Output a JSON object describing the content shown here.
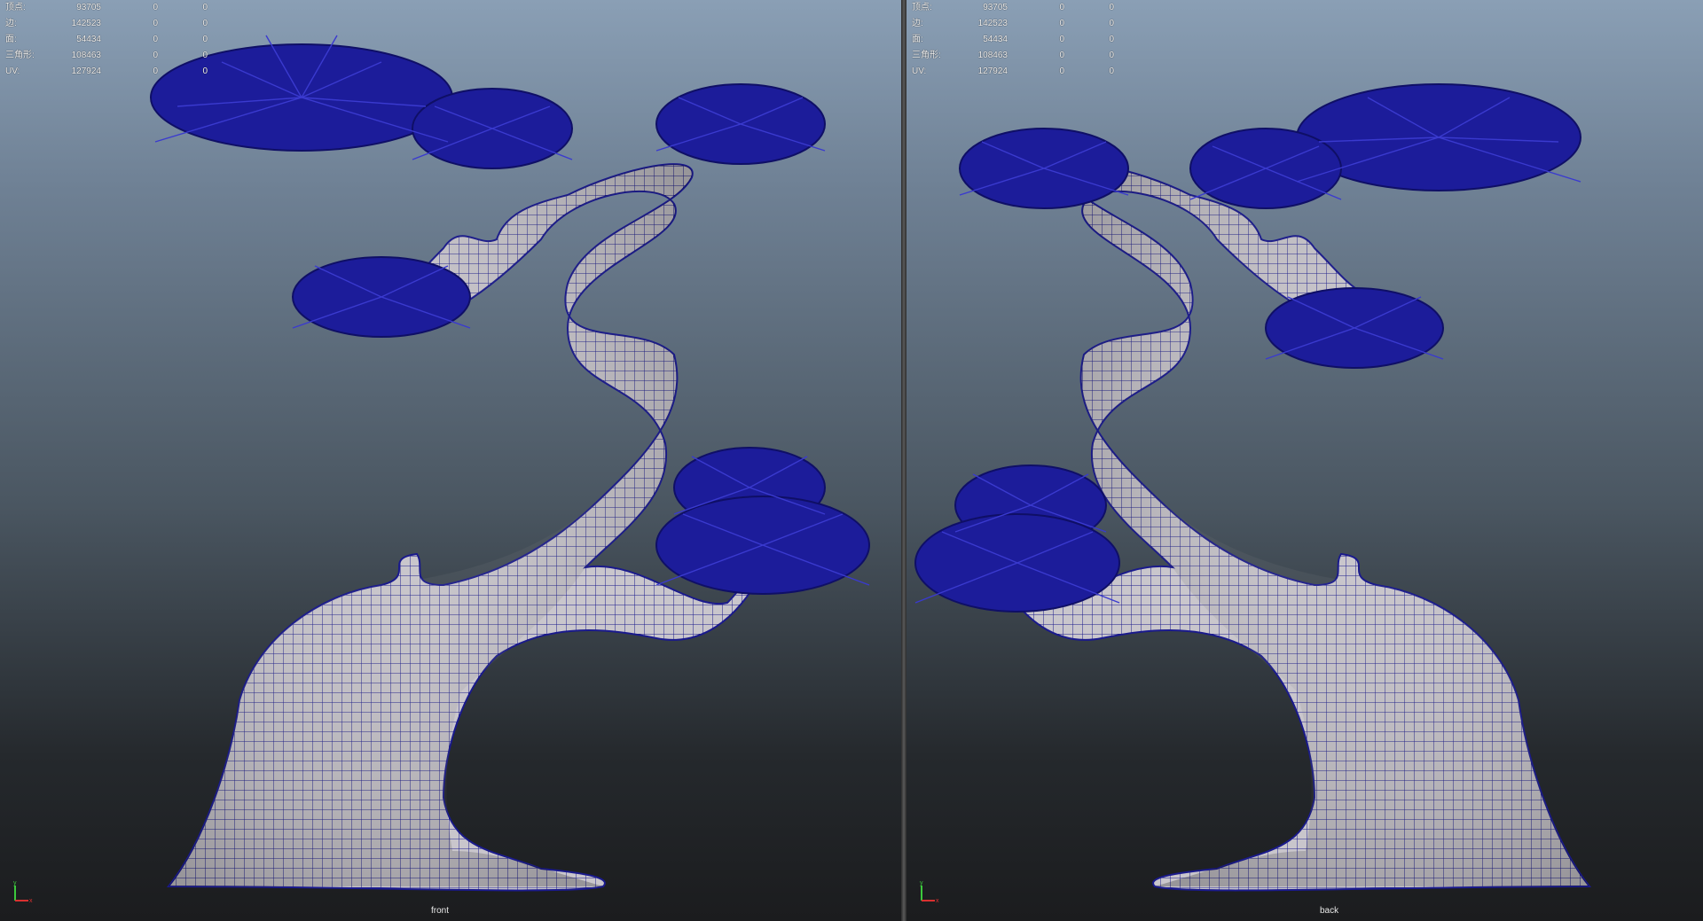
{
  "hud": {
    "rows": [
      {
        "label": "顶点:",
        "value": "93705",
        "sel": "0",
        "uv": "0"
      },
      {
        "label": "边:",
        "value": "142523",
        "sel": "0",
        "uv": "0"
      },
      {
        "label": "面:",
        "value": "54434",
        "sel": "0",
        "uv": "0"
      },
      {
        "label": "三角形:",
        "value": "108463",
        "sel": "0",
        "uv": "0"
      },
      {
        "label": "UV:",
        "value": "127924",
        "sel": "0",
        "uv": "0"
      }
    ]
  },
  "viewports": {
    "left": {
      "camera": "front"
    },
    "right": {
      "camera": "back"
    }
  },
  "axis": {
    "y_label": "y",
    "x_label": "x"
  },
  "colors": {
    "wire": "#1a1a8c",
    "foliage": "#1c1c9a",
    "mesh_fill": "#c9c6cc",
    "axis_y": "#3cc83c",
    "axis_x": "#d83030"
  }
}
